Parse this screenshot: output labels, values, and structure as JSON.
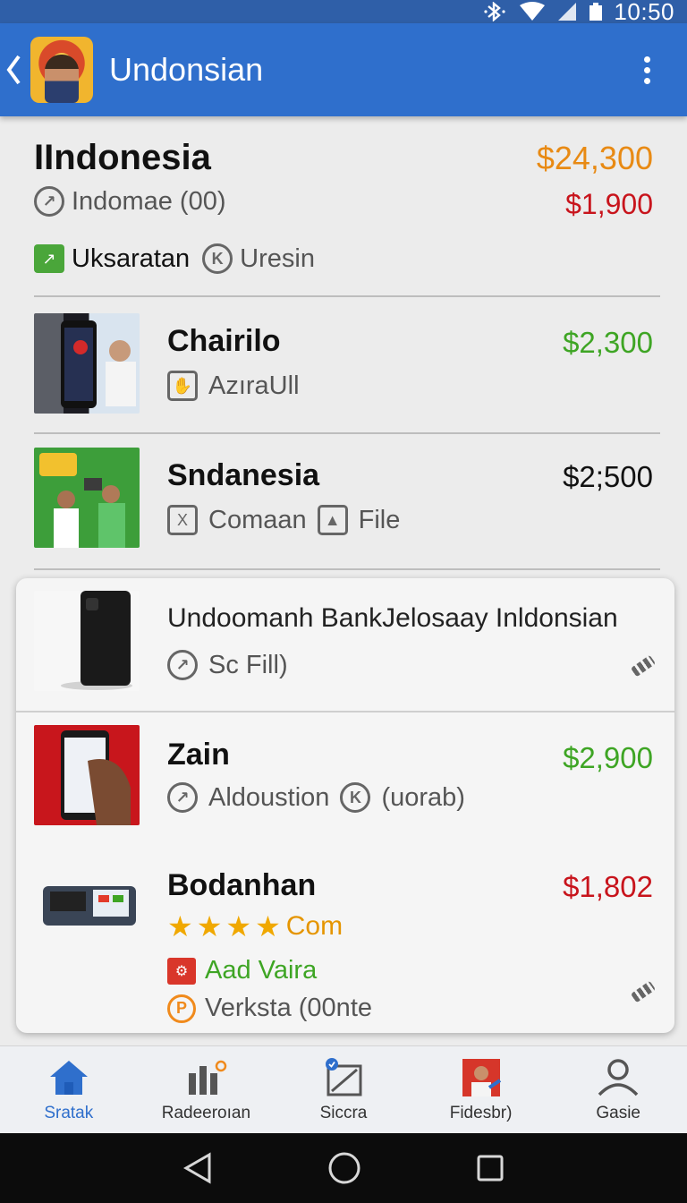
{
  "status_bar": {
    "time": "10:50"
  },
  "app_bar": {
    "title": "Undonsian"
  },
  "header": {
    "title": "IIndonesia",
    "price_main": "$24,300",
    "subtitle": "Indomae (00)",
    "price_sub": "$1,900",
    "tag1": "Uksaratan",
    "tag2": "Uresin"
  },
  "items": [
    {
      "title": "Chairilo",
      "price": "$2,300",
      "meta1": "AzırаUll"
    },
    {
      "title": "Sndanesia",
      "price": "$2;500",
      "meta1": "Comaan",
      "meta2": "File"
    }
  ],
  "card": {
    "row1": {
      "title": "Undoomanh BankJelosaay Inldonsian",
      "meta": "Sc Fill)"
    },
    "row2": {
      "title": "Zain",
      "price": "$2,900",
      "meta1": "Aldoustion",
      "meta2": "(uorab)"
    },
    "row3": {
      "title": "Bodanhan",
      "price": "$1,802",
      "rating_stars": 4,
      "rating_label": "Com",
      "tag1": "Aad Vaira",
      "tag2": "Verksta (00nte"
    }
  },
  "bottom_nav": [
    {
      "label": "Sratak",
      "icon": "home-icon",
      "active": true
    },
    {
      "label": "Radeeroıan",
      "icon": "stats-icon",
      "active": false
    },
    {
      "label": "Siccra",
      "icon": "compose-icon",
      "active": false
    },
    {
      "label": "Fidesbr)",
      "icon": "profile-photo-icon",
      "active": false
    },
    {
      "label": "Gasie",
      "icon": "person-icon",
      "active": false
    }
  ],
  "colors": {
    "app_bar": "#2f6fcc",
    "price_orange": "#e88a14",
    "price_red": "#c8141c",
    "price_green": "#3ea524"
  }
}
